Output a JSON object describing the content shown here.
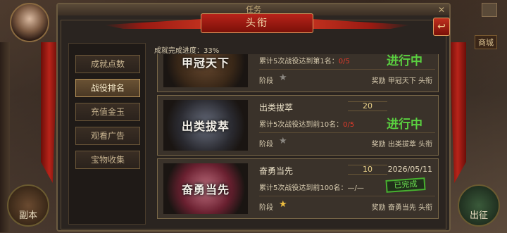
{
  "background": {
    "shop_label": "商城",
    "left_button_label": "副本",
    "right_button_label": "出征"
  },
  "panel": {
    "outer_title": "任务",
    "outer_close": "✕",
    "title": "头衔",
    "back_icon": "back-arrow-icon"
  },
  "nav": {
    "items": [
      {
        "label": "成就点数",
        "active": false
      },
      {
        "label": "战役排名",
        "active": true
      },
      {
        "label": "充值金玉",
        "active": false
      },
      {
        "label": "观看广告",
        "active": false
      },
      {
        "label": "宝物收集",
        "active": false
      }
    ]
  },
  "progress": {
    "label": "成就完成进度：33%"
  },
  "cards": [
    {
      "badge_text": "甲冠天下",
      "name": "",
      "count": "",
      "date": "",
      "desc_prefix": "累计5次战役达到第1名：",
      "desc_progress": "0/5",
      "stage_label": "阶段",
      "star_lit": false,
      "status": "进行中",
      "reward": "奖励  甲冠天下  头衔"
    },
    {
      "badge_text": "出类拔萃",
      "name": "出类拔萃",
      "count": "20",
      "date": "",
      "desc_prefix": "累计5次战役达到前10名：",
      "desc_progress": "0/5",
      "stage_label": "阶段",
      "star_lit": false,
      "status": "进行中",
      "reward": "奖励  出类拔萃  头衔"
    },
    {
      "badge_text": "奋勇当先",
      "name": "奋勇当先",
      "count": "10",
      "date": "2026/05/11",
      "desc_prefix": "累计5次战役达到前100名：",
      "desc_progress": "—/—",
      "stage_label": "阶段",
      "star_lit": true,
      "status": "已完成",
      "reward": "奖励  奋勇当先  头衔"
    }
  ],
  "colors": {
    "accent_red": "#b8231a",
    "in_progress_green": "#5ad040",
    "progress_red": "#e03a2a",
    "star_gold": "#f0c040"
  }
}
